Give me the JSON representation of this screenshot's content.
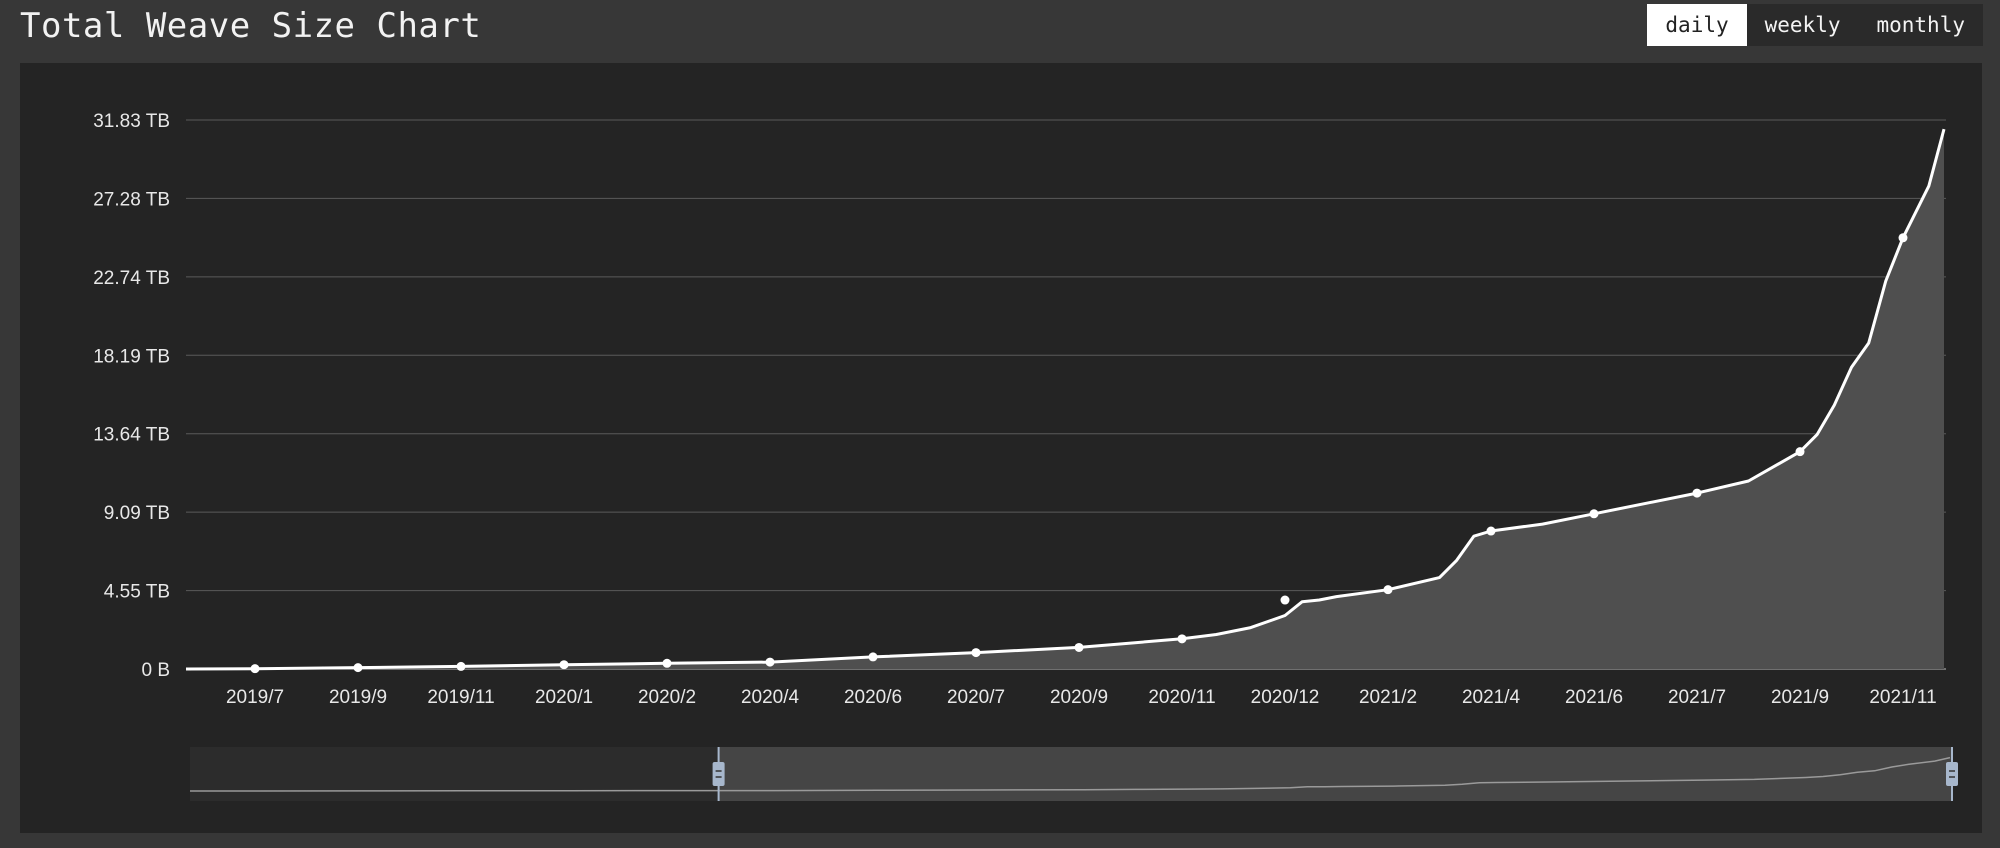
{
  "title": "Total Weave Size Chart",
  "tabs": [
    {
      "label": "daily",
      "active": true
    },
    {
      "label": "weekly",
      "active": false
    },
    {
      "label": "monthly",
      "active": false
    }
  ],
  "colors": {
    "page_background": "#373737",
    "panel_background": "#242424",
    "line": "#ffffff",
    "area_fill": "#4f4f4f",
    "gridline": "#5a5a5a",
    "slider_handle": "#a7b7cc"
  },
  "chart_data": {
    "type": "area",
    "title": "",
    "xlabel": "",
    "ylabel": "",
    "y_unit": "TB",
    "y_ticks": [
      "0 B",
      "4.55 TB",
      "9.09 TB",
      "13.64 TB",
      "18.19 TB",
      "22.74 TB",
      "27.28 TB",
      "31.83 TB"
    ],
    "ylim": [
      0,
      31.83
    ],
    "x_ticks": [
      "2019/7",
      "2019/9",
      "2019/11",
      "2020/1",
      "2020/2",
      "2020/4",
      "2020/6",
      "2020/7",
      "2020/9",
      "2020/11",
      "2020/12",
      "2021/2",
      "2021/4",
      "2021/6",
      "2021/7",
      "2021/9",
      "2021/11"
    ],
    "grid": true,
    "legend": "none",
    "series": [
      {
        "points": [
          [
            "2019/5",
            0.0
          ],
          [
            "2019/7",
            0.02
          ],
          [
            "2019/9",
            0.08
          ],
          [
            "2019/11",
            0.15
          ],
          [
            "2020/1",
            0.25
          ],
          [
            "2020/2",
            0.33
          ],
          [
            "2020/4",
            0.4
          ],
          [
            "2020/6",
            0.7
          ],
          [
            "2020/7",
            0.95
          ],
          [
            "2020/9",
            1.25
          ],
          [
            "2020/10",
            1.5
          ],
          [
            "2020/11",
            1.75
          ],
          [
            "2020/11",
            2.0
          ],
          [
            "2020/11",
            2.4
          ],
          [
            "2020/12",
            3.1
          ],
          [
            "2020/12",
            3.9
          ],
          [
            "2020/12",
            4.0
          ],
          [
            "2021/1",
            4.2
          ],
          [
            "2021/2",
            4.6
          ],
          [
            "2021/3",
            5.3
          ],
          [
            "2021/3",
            6.3
          ],
          [
            "2021/3",
            7.7
          ],
          [
            "2021/4",
            8.0
          ],
          [
            "2021/5",
            8.4
          ],
          [
            "2021/6",
            9.0
          ],
          [
            "2021/7",
            10.2
          ],
          [
            "2021/8",
            10.9
          ],
          [
            "2021/9",
            12.6
          ],
          [
            "2021/9",
            13.6
          ],
          [
            "2021/9",
            15.3
          ],
          [
            "2021/10",
            17.5
          ],
          [
            "2021/10",
            18.9
          ],
          [
            "2021/10",
            22.5
          ],
          [
            "2021/11",
            25.0
          ],
          [
            "2021/11",
            28.0
          ],
          [
            "2021/12",
            31.3
          ]
        ]
      }
    ],
    "markers_at_ticks": [
      0.02,
      0.08,
      0.15,
      0.25,
      0.33,
      0.4,
      0.7,
      0.95,
      1.25,
      1.75,
      4.0,
      4.6,
      8.0,
      9.0,
      10.2,
      12.6,
      25.0
    ],
    "zoom_window": {
      "start_fraction": 0.3,
      "end_fraction": 1.0
    }
  }
}
